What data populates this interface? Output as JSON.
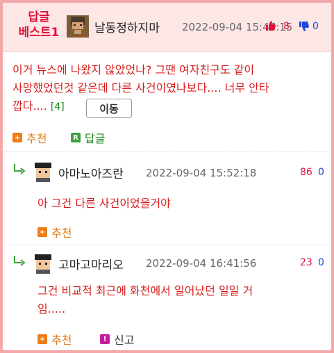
{
  "best": {
    "badge_line1": "답글",
    "badge_line2": "베스트1",
    "nickname": "날동정하지마",
    "datetime": "2022-09-04 15:47:15",
    "up_count": "8",
    "down_count": "0",
    "body_line1": "이거 뉴스에 나왔지 않았었나? 그땐 여자친구도 같이",
    "body_line2": "사망했었던것 같은데 다른 사건이였나보다.... 너무 안타",
    "body_line3": "깝다....",
    "reply_count": "[4]",
    "move_button": "이동",
    "recommend_label": "추천",
    "reply_label": "답글"
  },
  "replies": [
    {
      "nickname": "아마노아즈란",
      "datetime": "2022-09-04 15:52:18",
      "up_count": "86",
      "down_count": "0",
      "body": "아 그건 다른 사건이었을거야",
      "recommend_label": "추천"
    },
    {
      "nickname": "고마고마리오",
      "datetime": "2022-09-04 16:41:56",
      "up_count": "23",
      "down_count": "0",
      "body_line1": "그건 비교적 최근에 화천에서 일어났던 일일 거",
      "body_line2": "임.....",
      "recommend_label": "추천",
      "report_label": "신고"
    }
  ],
  "icons": {
    "thumbs_up": "thumbs-up-icon",
    "thumbs_down": "thumbs-down-icon",
    "plus": "plus-icon",
    "reply": "reply-icon",
    "report": "report-icon",
    "reply_arrow": "reply-arrow-icon"
  },
  "colors": {
    "accent_red": "#e0123a",
    "body_red": "#d81c1c",
    "down_blue": "#1c48d6",
    "recommend_orange": "#ef7c15",
    "reply_green": "#3aa13a",
    "border_pink": "#f3a9a9"
  }
}
